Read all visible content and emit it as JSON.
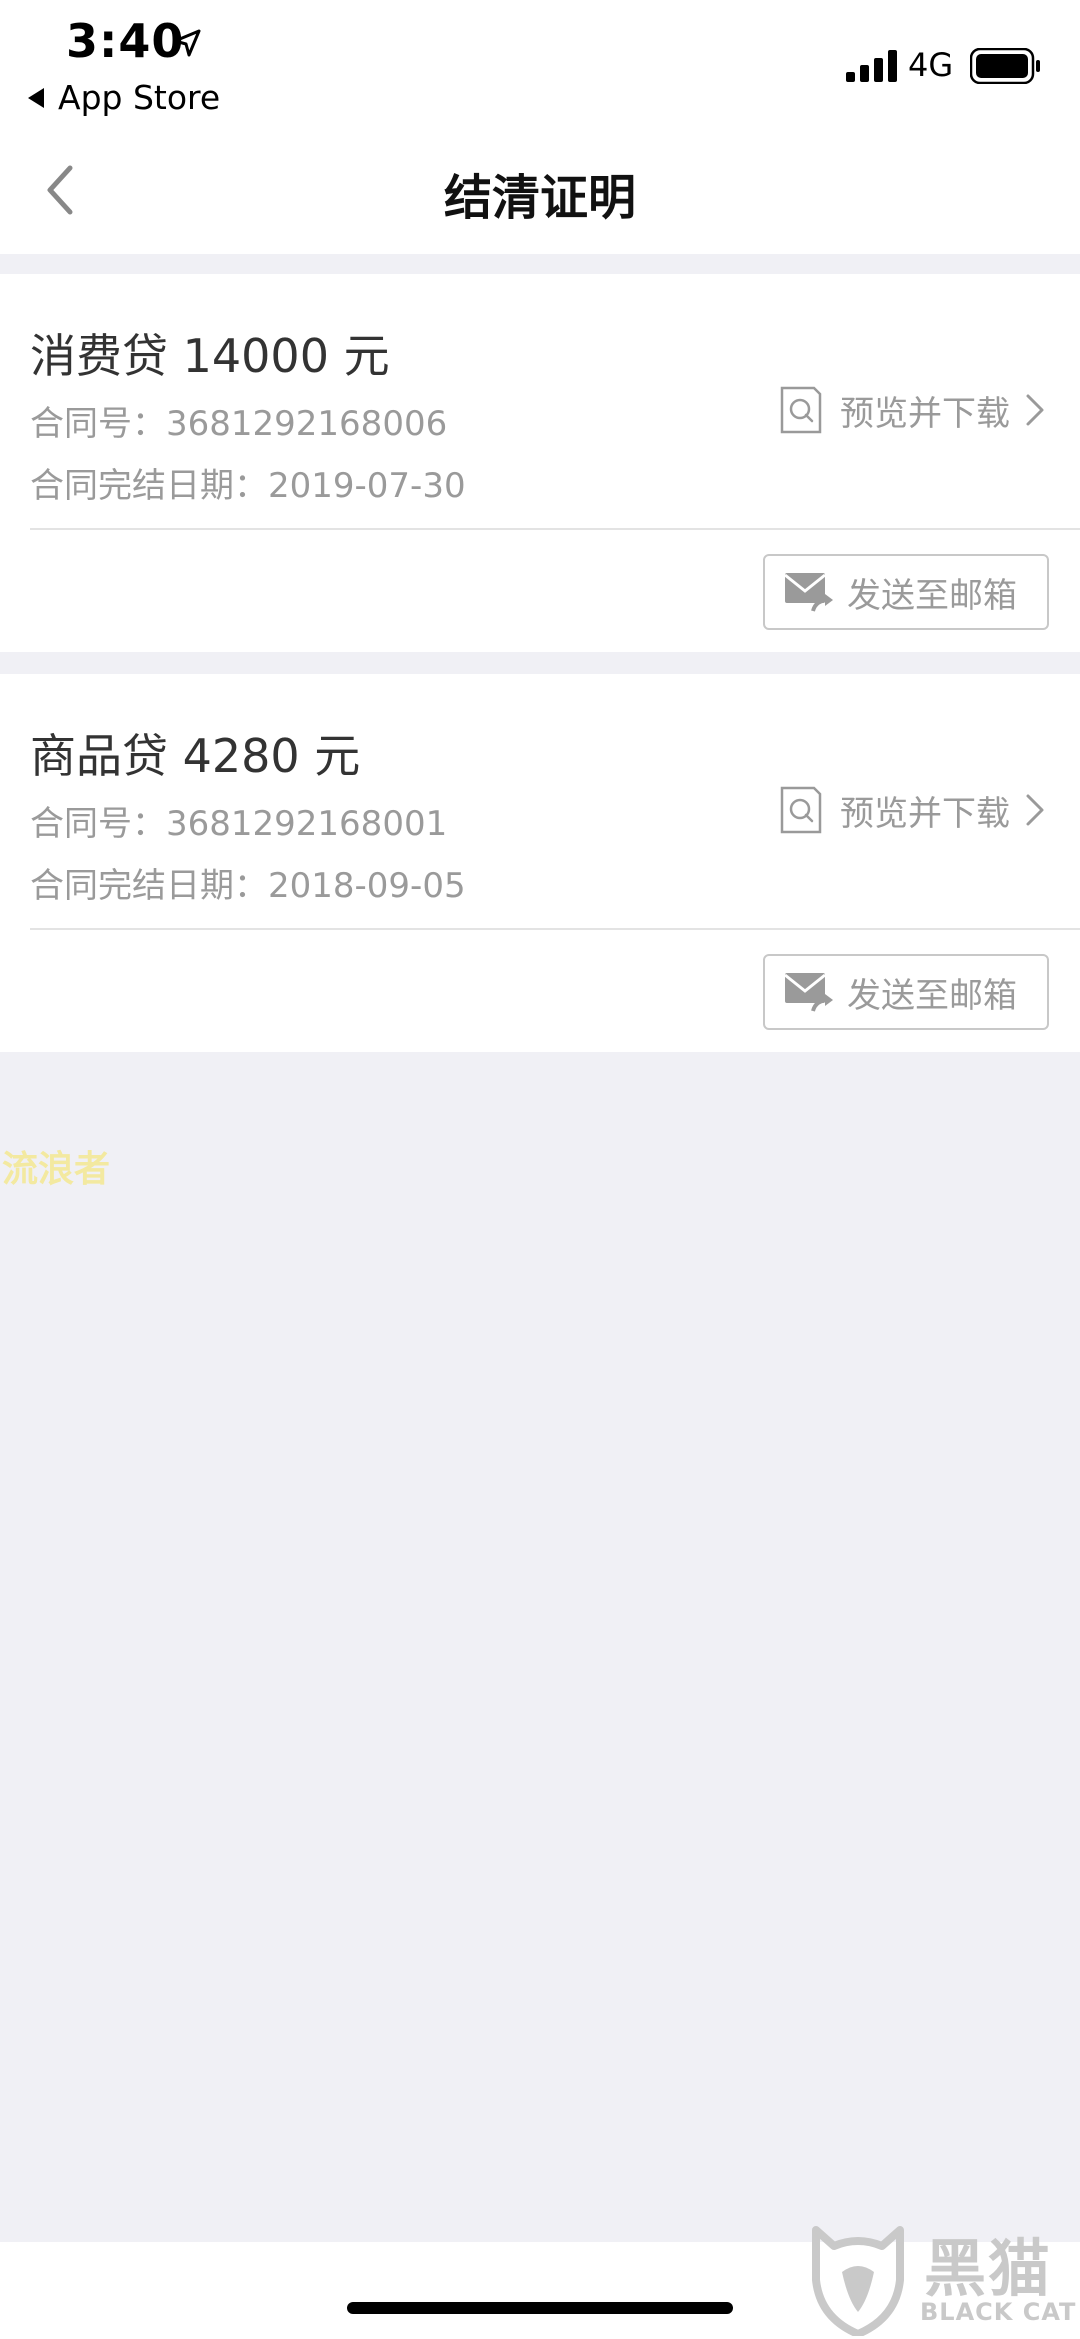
{
  "status_bar": {
    "time": "3:40",
    "back_app": "App Store",
    "network": "4G",
    "location_icon": "location-arrow-icon",
    "signal_icon": "signal-bars-icon",
    "battery_icon": "battery-icon"
  },
  "nav": {
    "title": "结清证明",
    "back_icon": "chevron-left-icon"
  },
  "cards": [
    {
      "title": "消费贷 14000 元",
      "contract_label": "合同号：",
      "contract_no": "3681292168006",
      "date_label": "合同完结日期：",
      "date": "2019-07-30",
      "preview_label": "预览并下载",
      "email_label": "发送至邮箱"
    },
    {
      "title": "商品贷 4280 元",
      "contract_label": "合同号：",
      "contract_no": "3681292168001",
      "date_label": "合同完结日期：",
      "date": "2018-09-05",
      "preview_label": "预览并下载",
      "email_label": "发送至邮箱"
    }
  ],
  "watermark": {
    "text": "流浪者"
  },
  "logo": {
    "title": "黑猫",
    "subtitle": "BLACK CAT"
  },
  "colors": {
    "background": "#f0f0f5",
    "card": "#ffffff",
    "muted_text": "#9a9a9a",
    "title_text": "#111111"
  }
}
